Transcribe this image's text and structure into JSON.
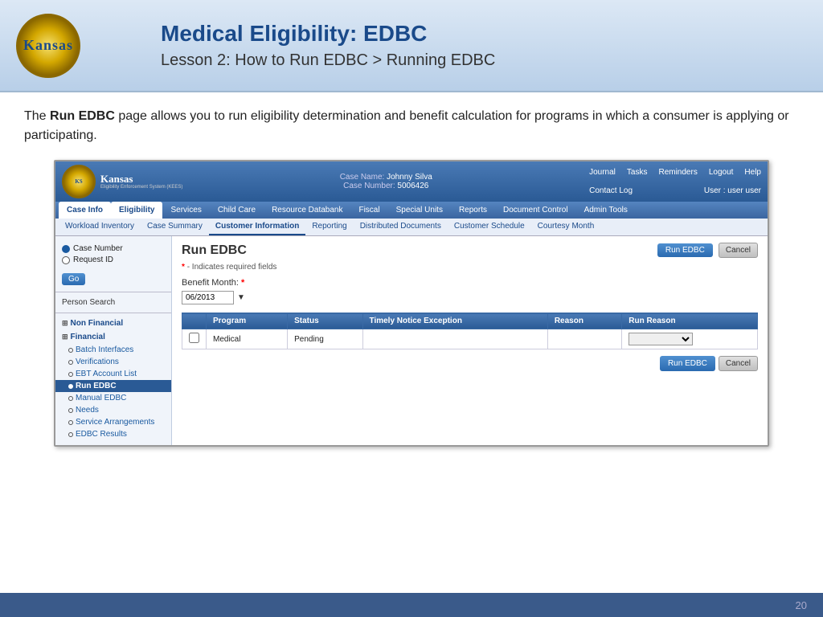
{
  "header": {
    "main_title": "Medical Eligibility: EDBC",
    "sub_title": "Lesson 2: How to Run EDBC > Running EDBC",
    "logo_kansas": "Kansas",
    "logo_sub": "Eligibility Enforcement System (KEES)"
  },
  "intro": {
    "text_before_bold": "The ",
    "bold_text": "Run EDBC",
    "text_after_bold": " page allows you to run eligibility determination and benefit calculation for programs in which a consumer is applying or participating."
  },
  "app": {
    "case_name_label": "Case Name:",
    "case_name_value": "Johnny Silva",
    "case_number_label": "Case Number:",
    "case_number_value": "5006426",
    "top_links": [
      "Journal",
      "Tasks",
      "Reminders",
      "Logout",
      "Help"
    ],
    "contact_log": "Contact Log",
    "user_label": "User : user user",
    "main_nav_tabs": [
      {
        "label": "Case Info",
        "active": false
      },
      {
        "label": "Eligibility",
        "active": true
      },
      {
        "label": "Services",
        "active": false
      },
      {
        "label": "Child Care",
        "active": false
      },
      {
        "label": "Resource Databank",
        "active": false
      },
      {
        "label": "Fiscal",
        "active": false
      },
      {
        "label": "Special Units",
        "active": false
      },
      {
        "label": "Reports",
        "active": false
      },
      {
        "label": "Document Control",
        "active": false
      },
      {
        "label": "Admin Tools",
        "active": false
      }
    ],
    "sub_nav_tabs": [
      {
        "label": "Workload Inventory",
        "active": false
      },
      {
        "label": "Case Summary",
        "active": false
      },
      {
        "label": "Customer Information",
        "active": true
      },
      {
        "label": "Reporting",
        "active": false
      },
      {
        "label": "Distributed Documents",
        "active": false
      },
      {
        "label": "Customer Schedule",
        "active": false
      },
      {
        "label": "Courtesy Month",
        "active": false
      }
    ],
    "sidebar": {
      "radio_options": [
        {
          "label": "Case Number",
          "selected": true
        },
        {
          "label": "Request ID",
          "selected": false
        }
      ],
      "go_button": "Go",
      "person_search": "Person Search",
      "sections": [
        {
          "label": "Non Financial",
          "expanded": true,
          "items": []
        },
        {
          "label": "Financial",
          "expanded": true,
          "items": [
            {
              "label": "Batch Interfaces",
              "active": false
            },
            {
              "label": "Verifications",
              "active": false
            },
            {
              "label": "EBT Account List",
              "active": false
            }
          ]
        }
      ],
      "active_section": "Run EDBC",
      "sub_items": [
        {
          "label": "Manual EDBC",
          "active": false
        },
        {
          "label": "Needs",
          "active": false
        },
        {
          "label": "Service Arrangements",
          "active": false
        },
        {
          "label": "EDBC Results",
          "active": false
        }
      ]
    },
    "main": {
      "page_title": "Run EDBC",
      "run_edbc_btn": "Run EDBC",
      "cancel_btn": "Cancel",
      "required_note": "* - Indicates required fields",
      "benefit_month_label": "Benefit Month:",
      "benefit_month_value": "06/2013",
      "table_headers": [
        "",
        "Program",
        "Status",
        "Timely Notice Exception",
        "Reason",
        "Run Reason"
      ],
      "table_rows": [
        {
          "checked": false,
          "program": "Medical",
          "status": "Pending",
          "timely_notice": "",
          "reason": "",
          "run_reason": ""
        }
      ]
    }
  },
  "footer": {
    "page_number": "20"
  }
}
